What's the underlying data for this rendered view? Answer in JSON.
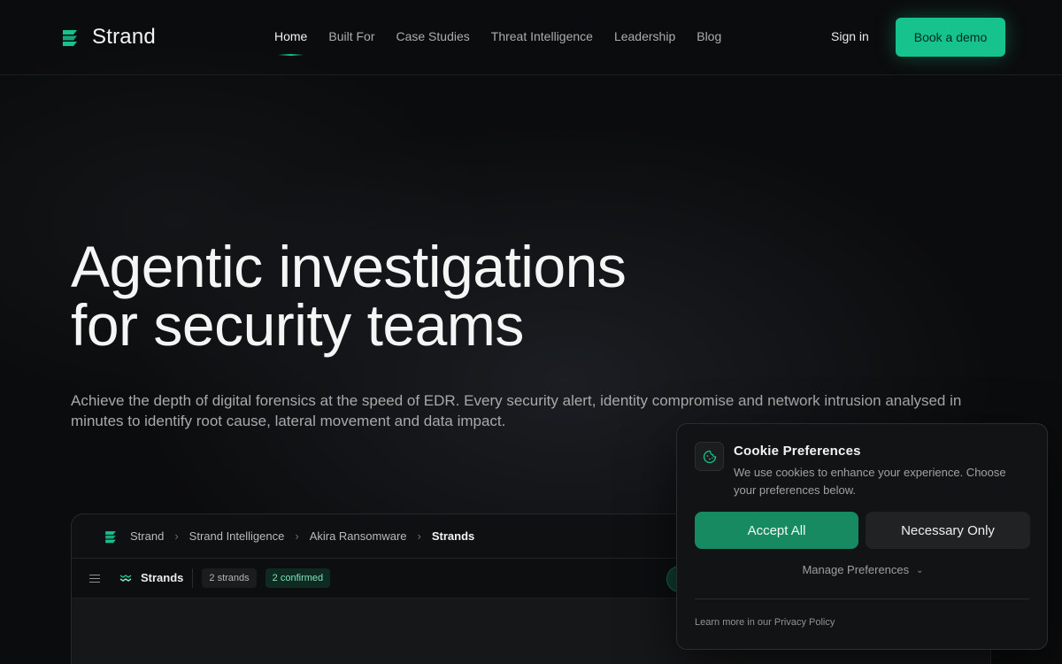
{
  "brand": {
    "name": "Strand",
    "accent": "#16c38c"
  },
  "nav": {
    "links": [
      "Home",
      "Built For",
      "Case Studies",
      "Threat Intelligence",
      "Leadership",
      "Blog"
    ],
    "active": "Home",
    "sign_in": "Sign in",
    "cta": "Book a demo"
  },
  "hero": {
    "title_line1": "Agentic investigations",
    "title_line2": "for security teams",
    "subtitle": "Achieve the depth of digital forensics at the speed of EDR. Every security alert, identity compromise and network intrusion analysed in minutes to identify root cause, lateral movement and data impact."
  },
  "app_preview": {
    "breadcrumb": [
      "Strand",
      "Strand Intelligence",
      "Akira Ransomware",
      "Strands"
    ],
    "toolbar": {
      "title": "Strands",
      "count_badge": "2 strands",
      "confirmed_badge": "2 confirmed"
    }
  },
  "cookie": {
    "title": "Cookie Preferences",
    "text": "We use cookies to enhance your experience. Choose your preferences below.",
    "accept": "Accept All",
    "necessary": "Necessary Only",
    "manage": "Manage Preferences",
    "privacy": "Learn more in our Privacy Policy",
    "icon": "cookie-icon"
  }
}
